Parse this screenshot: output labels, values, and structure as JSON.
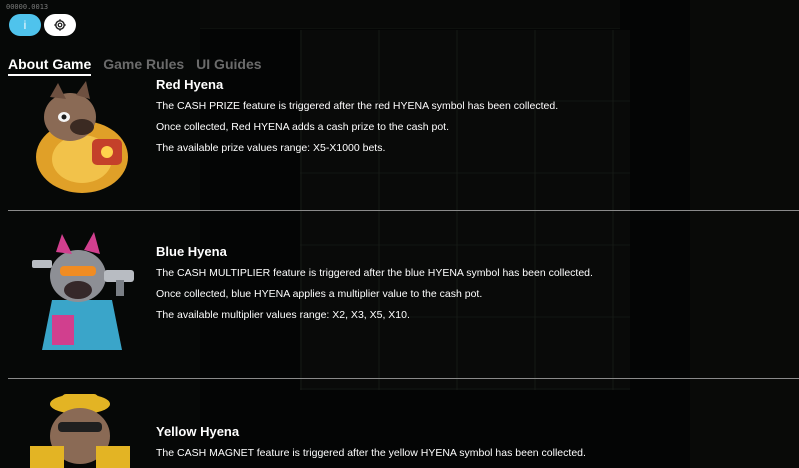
{
  "build_id": "00000.0013",
  "buttons": {
    "info_label": "i",
    "settings_icon": "gear-icon"
  },
  "tabs": [
    {
      "label": "About Game",
      "active": true
    },
    {
      "label": "Game Rules",
      "active": false
    },
    {
      "label": "UI Guides",
      "active": false
    }
  ],
  "sections": [
    {
      "title": "Red Hyena",
      "lines": [
        "The CASH PRIZE feature is triggered after the red HYENA symbol has been collected.",
        "Once collected, Red HYENA adds a cash prize to the cash pot.",
        "The available prize values range: X5-X1000 bets."
      ],
      "art_icon": "red-hyena-icon",
      "art_color": "#c4402a"
    },
    {
      "title": "Blue Hyena",
      "lines": [
        "The CASH MULTIPLIER feature is triggered after the blue HYENA symbol has been collected.",
        "Once collected, blue HYENA applies a multiplier value to the cash pot.",
        "The available multiplier values range: X2, X3, X5, X10."
      ],
      "art_icon": "blue-hyena-icon",
      "art_color": "#3d7fc9"
    },
    {
      "title": "Yellow Hyena",
      "lines": [
        "The CASH MAGNET feature is triggered after the yellow HYENA symbol has been collected."
      ],
      "art_icon": "yellow-hyena-icon",
      "art_color": "#e3b424"
    }
  ]
}
